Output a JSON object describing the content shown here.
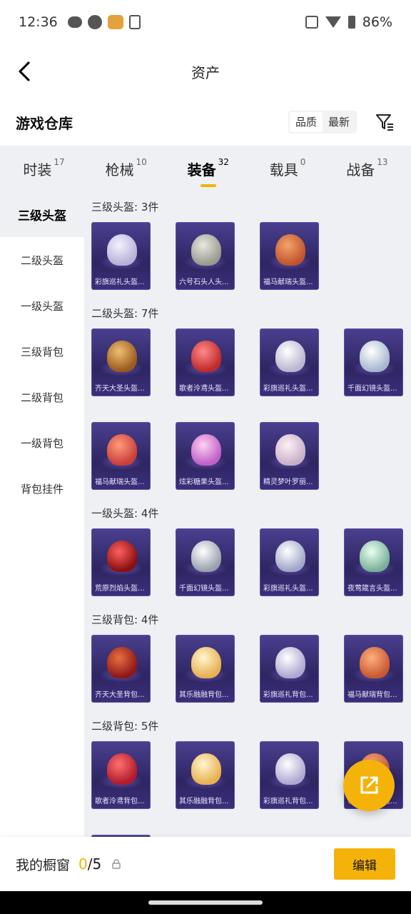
{
  "status": {
    "time": "12:36",
    "battery": "86%"
  },
  "header": {
    "title": "资产"
  },
  "section": {
    "title": "游戏仓库",
    "sort_quality": "品质",
    "sort_latest": "最新"
  },
  "tabs": [
    {
      "label": "时装",
      "count": "17"
    },
    {
      "label": "枪械",
      "count": "10"
    },
    {
      "label": "装备",
      "count": "32"
    },
    {
      "label": "载具",
      "count": "0"
    },
    {
      "label": "战备",
      "count": "13"
    }
  ],
  "sidebar": [
    {
      "label": "三级头盔"
    },
    {
      "label": "二级头盔"
    },
    {
      "label": "一级头盔"
    },
    {
      "label": "三级背包"
    },
    {
      "label": "二级背包"
    },
    {
      "label": "一级背包"
    },
    {
      "label": "背包挂件"
    }
  ],
  "groups": [
    {
      "label": "三级头盔: 3件",
      "items": [
        "彩旗巡礼头盔...",
        "六号石头人头...",
        "福马献瑞头盔..."
      ]
    },
    {
      "label": "二级头盔: 7件",
      "items": [
        "齐天大圣头盔...",
        "歌者泠鸢头盔...",
        "彩旗巡礼头盔...",
        "千面幻镜头盔...",
        "福马献瑞头盔...",
        "炫彩糖果头盔...",
        "精灵梦叶罗丽..."
      ]
    },
    {
      "label": "一级头盔: 4件",
      "items": [
        "荒原烈焰头盔...",
        "千面幻镜头盔...",
        "彩旗巡礼头盔...",
        "夜莺箴言头盔..."
      ]
    },
    {
      "label": "三级背包: 4件",
      "items": [
        "齐天大圣背包...",
        "其乐融融背包...",
        "彩旗巡礼背包...",
        "福马献瑞背包..."
      ]
    },
    {
      "label": "二级背包: 5件",
      "items": [
        "歌者泠鸢背包...",
        "其乐融融背包...",
        "彩旗巡礼背包...",
        "福马献瑞背包...",
        ""
      ]
    }
  ],
  "showcase": {
    "label": "我的橱窗",
    "current": "0",
    "total": "/5",
    "edit": "编辑"
  },
  "colors": {
    "accent": "#f5b30a",
    "tile_bg": "#2e2562"
  }
}
